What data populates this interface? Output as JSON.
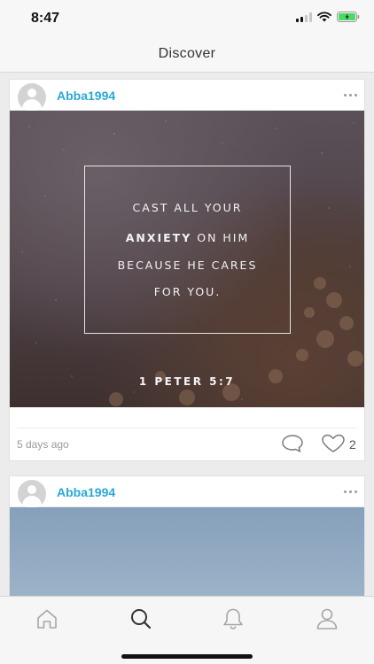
{
  "status_bar": {
    "time": "8:47"
  },
  "nav": {
    "title": "Discover"
  },
  "posts": [
    {
      "username": "Abba1994",
      "image": {
        "quote_lines": [
          {
            "prefix": "CAST ALL YOUR",
            "bold": "",
            "suffix": ""
          },
          {
            "prefix": "",
            "bold": "ANXIETY",
            "suffix": " ON HIM"
          },
          {
            "prefix": "BECAUSE HE CARES",
            "bold": "",
            "suffix": ""
          },
          {
            "prefix": "FOR YOU.",
            "bold": "",
            "suffix": ""
          }
        ],
        "reference": "1 PETER 5:7"
      },
      "time_ago": "5 days ago",
      "like_count": "2"
    },
    {
      "username": "Abba1994"
    }
  ],
  "tab_bar": {
    "items": [
      {
        "icon": "home-icon",
        "active": false
      },
      {
        "icon": "search-icon",
        "active": true
      },
      {
        "icon": "bell-icon",
        "active": false
      },
      {
        "icon": "profile-icon",
        "active": false
      }
    ]
  },
  "colors": {
    "username": "#29a8d6",
    "battery": "#4cd964",
    "active_tab": "#333333",
    "inactive_tab": "#a6a6a6"
  }
}
